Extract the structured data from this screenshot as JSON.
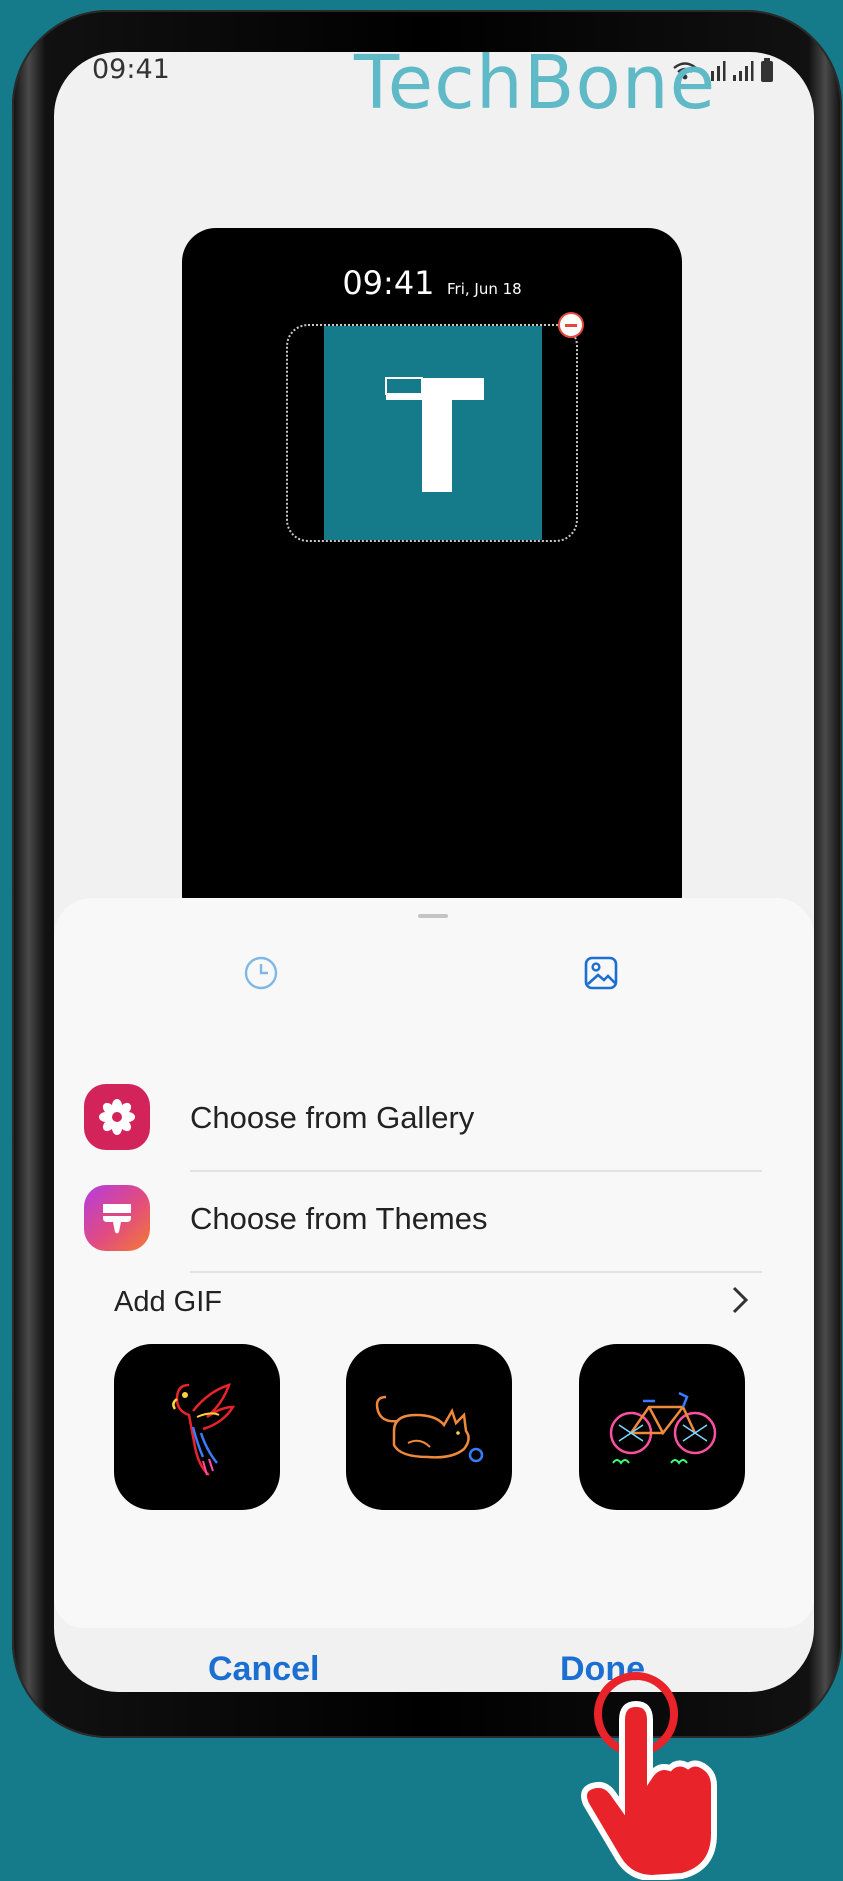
{
  "status_bar": {
    "time": "09:41"
  },
  "watermark": "TechBone",
  "lock_preview": {
    "time": "09:41",
    "date": "Fri, Jun 18",
    "widget_letter": "T"
  },
  "sheet": {
    "options": [
      {
        "label": "Choose from Gallery",
        "icon": "gallery-icon"
      },
      {
        "label": "Choose from Themes",
        "icon": "themes-icon"
      }
    ],
    "add_gif_label": "Add GIF",
    "gifs": [
      "parrot-gif",
      "cat-gif",
      "bicycle-gif"
    ]
  },
  "footer": {
    "cancel": "Cancel",
    "done": "Done"
  },
  "colors": {
    "background": "#157a89",
    "accent": "#1a6fd1",
    "gallery_icon": "#d3235b",
    "tap_hand": "#e8232a"
  }
}
